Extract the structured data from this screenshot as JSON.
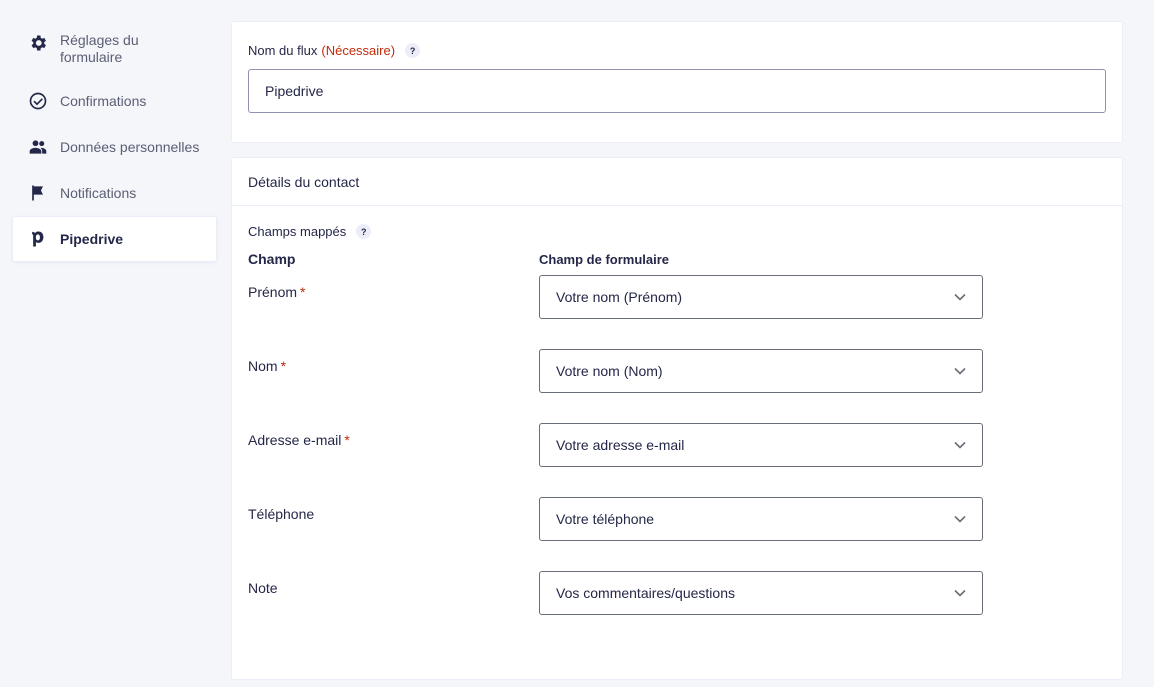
{
  "sidebar": {
    "items": [
      {
        "label": "Réglages du formulaire",
        "icon": "gear-icon"
      },
      {
        "label": "Confirmations",
        "icon": "check-circle-icon"
      },
      {
        "label": "Données personnelles",
        "icon": "users-icon"
      },
      {
        "label": "Notifications",
        "icon": "flag-icon"
      },
      {
        "label": "Pipedrive",
        "icon": "pipedrive-icon",
        "active": true
      }
    ]
  },
  "feed": {
    "label": "Nom du flux",
    "required": "(Nécessaire)",
    "help": "?",
    "value": "Pipedrive"
  },
  "contact": {
    "title": "Détails du contact",
    "mapped_label": "Champs mappés",
    "help": "?",
    "col_field": "Champ",
    "col_form": "Champ de formulaire",
    "rows": [
      {
        "label": "Prénom",
        "required": "*",
        "value": "Votre nom (Prénom)"
      },
      {
        "label": "Nom",
        "required": "*",
        "value": "Votre nom (Nom)"
      },
      {
        "label": "Adresse e-mail",
        "required": "*",
        "value": "Votre adresse e-mail"
      },
      {
        "label": "Téléphone",
        "required": "",
        "value": "Votre téléphone"
      },
      {
        "label": "Note",
        "required": "",
        "value": "Vos commentaires/questions"
      }
    ]
  },
  "colors": {
    "accent_required": "#c02b0a",
    "text": "#242748",
    "background": "#f4f6fa"
  }
}
